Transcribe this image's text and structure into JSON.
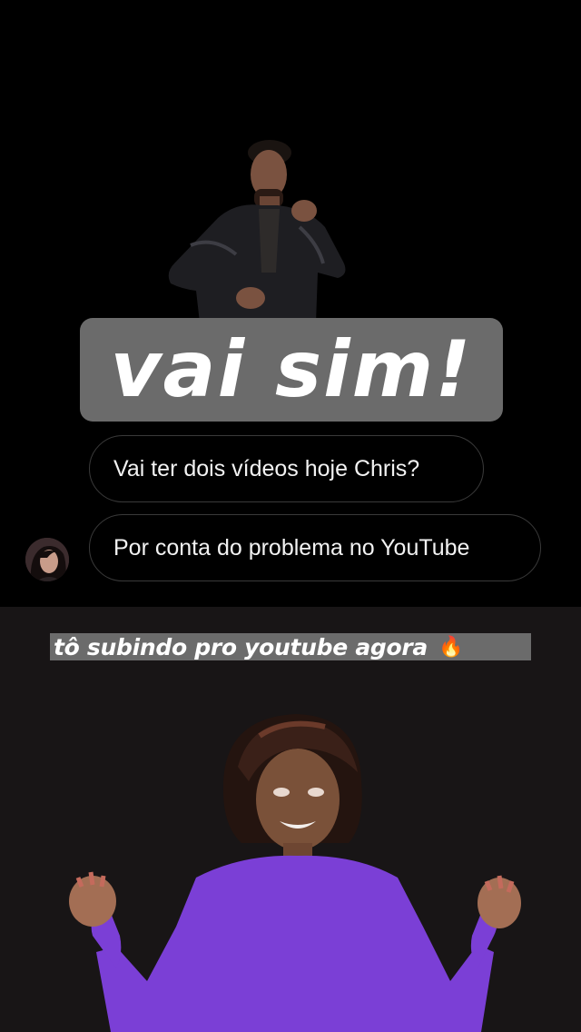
{
  "stickers": {
    "headline": "vai sim!",
    "man_gif_icon": "dancing-man-gif",
    "woman_gif_icon": "dancing-woman-gif"
  },
  "messages": [
    {
      "text": "Vai ter dois vídeos hoje Chris?"
    },
    {
      "text": "Por conta do problema no YouTube"
    }
  ],
  "reply": {
    "caption": "tô subindo pro youtube agora",
    "emoji": "🔥"
  },
  "colors": {
    "background_top": "#000000",
    "background_bottom": "#181516",
    "sticker_bg": "#6b6b6b",
    "bubble_border": "#3a3a3a",
    "shirt_purple": "#7b3fd6"
  }
}
